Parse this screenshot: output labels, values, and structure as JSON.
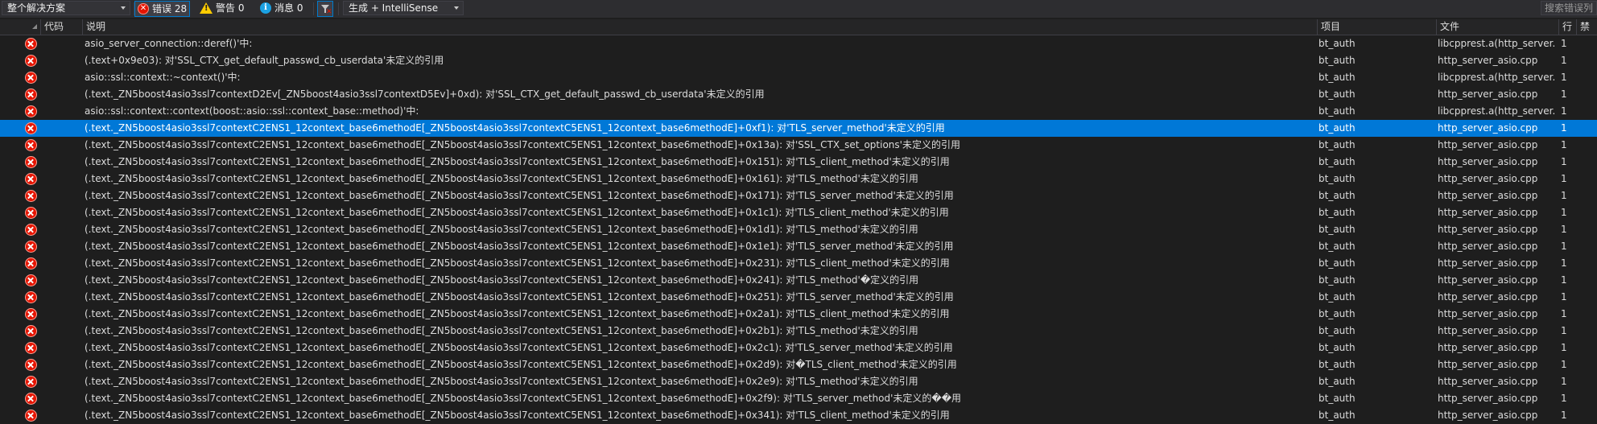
{
  "toolbar": {
    "scope_dropdown": "整个解决方案",
    "errors_label": "错误 28",
    "warnings_label": "警告 0",
    "messages_label": "消息 0",
    "filter_icon": "filter-icon",
    "build_filter_dropdown": "生成 + IntelliSense",
    "search_placeholder": "搜索错误列"
  },
  "columns": {
    "code": "代码",
    "description": "说明",
    "project": "项目",
    "file": "文件",
    "line": "行",
    "suppression": "禁"
  },
  "selected_row_index": 5,
  "colors": {
    "accent": "#007acc",
    "selection": "#0078d7",
    "error_red": "#e51400",
    "background": "#1e1e1e"
  },
  "rows": [
    {
      "desc": "asio_server_connection::deref()'中:",
      "project": "bt_auth",
      "file": "libcpprest.a(http_server...",
      "line": "1"
    },
    {
      "desc": "(.text+0x9e03): 对'SSL_CTX_get_default_passwd_cb_userdata'未定义的引用",
      "project": "bt_auth",
      "file": "http_server_asio.cpp",
      "line": "1"
    },
    {
      "desc": "asio::ssl::context::~context()'中:",
      "project": "bt_auth",
      "file": "libcpprest.a(http_server...",
      "line": "1"
    },
    {
      "desc": "(.text._ZN5boost4asio3ssl7contextD2Ev[_ZN5boost4asio3ssl7contextD5Ev]+0xd): 对'SSL_CTX_get_default_passwd_cb_userdata'未定义的引用",
      "project": "bt_auth",
      "file": "http_server_asio.cpp",
      "line": "1"
    },
    {
      "desc": "asio::ssl::context::context(boost::asio::ssl::context_base::method)'中:",
      "project": "bt_auth",
      "file": "libcpprest.a(http_server...",
      "line": "1"
    },
    {
      "desc": "(.text._ZN5boost4asio3ssl7contextC2ENS1_12context_base6methodE[_ZN5boost4asio3ssl7contextC5ENS1_12context_base6methodE]+0xf1): 对'TLS_server_method'未定义的引用",
      "project": "bt_auth",
      "file": "http_server_asio.cpp",
      "line": "1"
    },
    {
      "desc": "(.text._ZN5boost4asio3ssl7contextC2ENS1_12context_base6methodE[_ZN5boost4asio3ssl7contextC5ENS1_12context_base6methodE]+0x13a): 对'SSL_CTX_set_options'未定义的引用",
      "project": "bt_auth",
      "file": "http_server_asio.cpp",
      "line": "1"
    },
    {
      "desc": "(.text._ZN5boost4asio3ssl7contextC2ENS1_12context_base6methodE[_ZN5boost4asio3ssl7contextC5ENS1_12context_base6methodE]+0x151): 对'TLS_client_method'未定义的引用",
      "project": "bt_auth",
      "file": "http_server_asio.cpp",
      "line": "1"
    },
    {
      "desc": "(.text._ZN5boost4asio3ssl7contextC2ENS1_12context_base6methodE[_ZN5boost4asio3ssl7contextC5ENS1_12context_base6methodE]+0x161): 对'TLS_method'未定义的引用",
      "project": "bt_auth",
      "file": "http_server_asio.cpp",
      "line": "1"
    },
    {
      "desc": "(.text._ZN5boost4asio3ssl7contextC2ENS1_12context_base6methodE[_ZN5boost4asio3ssl7contextC5ENS1_12context_base6methodE]+0x171): 对'TLS_server_method'未定义的引用",
      "project": "bt_auth",
      "file": "http_server_asio.cpp",
      "line": "1"
    },
    {
      "desc": "(.text._ZN5boost4asio3ssl7contextC2ENS1_12context_base6methodE[_ZN5boost4asio3ssl7contextC5ENS1_12context_base6methodE]+0x1c1): 对'TLS_client_method'未定义的引用",
      "project": "bt_auth",
      "file": "http_server_asio.cpp",
      "line": "1"
    },
    {
      "desc": "(.text._ZN5boost4asio3ssl7contextC2ENS1_12context_base6methodE[_ZN5boost4asio3ssl7contextC5ENS1_12context_base6methodE]+0x1d1): 对'TLS_method'未定义的引用",
      "project": "bt_auth",
      "file": "http_server_asio.cpp",
      "line": "1"
    },
    {
      "desc": "(.text._ZN5boost4asio3ssl7contextC2ENS1_12context_base6methodE[_ZN5boost4asio3ssl7contextC5ENS1_12context_base6methodE]+0x1e1): 对'TLS_server_method'未定义的引用",
      "project": "bt_auth",
      "file": "http_server_asio.cpp",
      "line": "1"
    },
    {
      "desc": "(.text._ZN5boost4asio3ssl7contextC2ENS1_12context_base6methodE[_ZN5boost4asio3ssl7contextC5ENS1_12context_base6methodE]+0x231): 对'TLS_client_method'未定义的引用",
      "project": "bt_auth",
      "file": "http_server_asio.cpp",
      "line": "1"
    },
    {
      "desc": "(.text._ZN5boost4asio3ssl7contextC2ENS1_12context_base6methodE[_ZN5boost4asio3ssl7contextC5ENS1_12context_base6methodE]+0x241): 对'TLS_method'�定义的引用",
      "project": "bt_auth",
      "file": "http_server_asio.cpp",
      "line": "1"
    },
    {
      "desc": "(.text._ZN5boost4asio3ssl7contextC2ENS1_12context_base6methodE[_ZN5boost4asio3ssl7contextC5ENS1_12context_base6methodE]+0x251): 对'TLS_server_method'未定义的引用",
      "project": "bt_auth",
      "file": "http_server_asio.cpp",
      "line": "1"
    },
    {
      "desc": "(.text._ZN5boost4asio3ssl7contextC2ENS1_12context_base6methodE[_ZN5boost4asio3ssl7contextC5ENS1_12context_base6methodE]+0x2a1): 对'TLS_client_method'未定义的引用",
      "project": "bt_auth",
      "file": "http_server_asio.cpp",
      "line": "1"
    },
    {
      "desc": "(.text._ZN5boost4asio3ssl7contextC2ENS1_12context_base6methodE[_ZN5boost4asio3ssl7contextC5ENS1_12context_base6methodE]+0x2b1): 对'TLS_method'未定义的引用",
      "project": "bt_auth",
      "file": "http_server_asio.cpp",
      "line": "1"
    },
    {
      "desc": "(.text._ZN5boost4asio3ssl7contextC2ENS1_12context_base6methodE[_ZN5boost4asio3ssl7contextC5ENS1_12context_base6methodE]+0x2c1): 对'TLS_server_method'未定义的引用",
      "project": "bt_auth",
      "file": "http_server_asio.cpp",
      "line": "1"
    },
    {
      "desc": "(.text._ZN5boost4asio3ssl7contextC2ENS1_12context_base6methodE[_ZN5boost4asio3ssl7contextC5ENS1_12context_base6methodE]+0x2d9): 对�TLS_client_method'未定义的引用",
      "project": "bt_auth",
      "file": "http_server_asio.cpp",
      "line": "1"
    },
    {
      "desc": "(.text._ZN5boost4asio3ssl7contextC2ENS1_12context_base6methodE[_ZN5boost4asio3ssl7contextC5ENS1_12context_base6methodE]+0x2e9): 对'TLS_method'未定义的引用",
      "project": "bt_auth",
      "file": "http_server_asio.cpp",
      "line": "1"
    },
    {
      "desc": "(.text._ZN5boost4asio3ssl7contextC2ENS1_12context_base6methodE[_ZN5boost4asio3ssl7contextC5ENS1_12context_base6methodE]+0x2f9): 对'TLS_server_method'未定义的��用",
      "project": "bt_auth",
      "file": "http_server_asio.cpp",
      "line": "1"
    },
    {
      "desc": "(.text._ZN5boost4asio3ssl7contextC2ENS1_12context_base6methodE[_ZN5boost4asio3ssl7contextC5ENS1_12context_base6methodE]+0x341): 对'TLS_client_method'未定义的引用",
      "project": "bt_auth",
      "file": "http_server_asio.cpp",
      "line": "1"
    }
  ]
}
